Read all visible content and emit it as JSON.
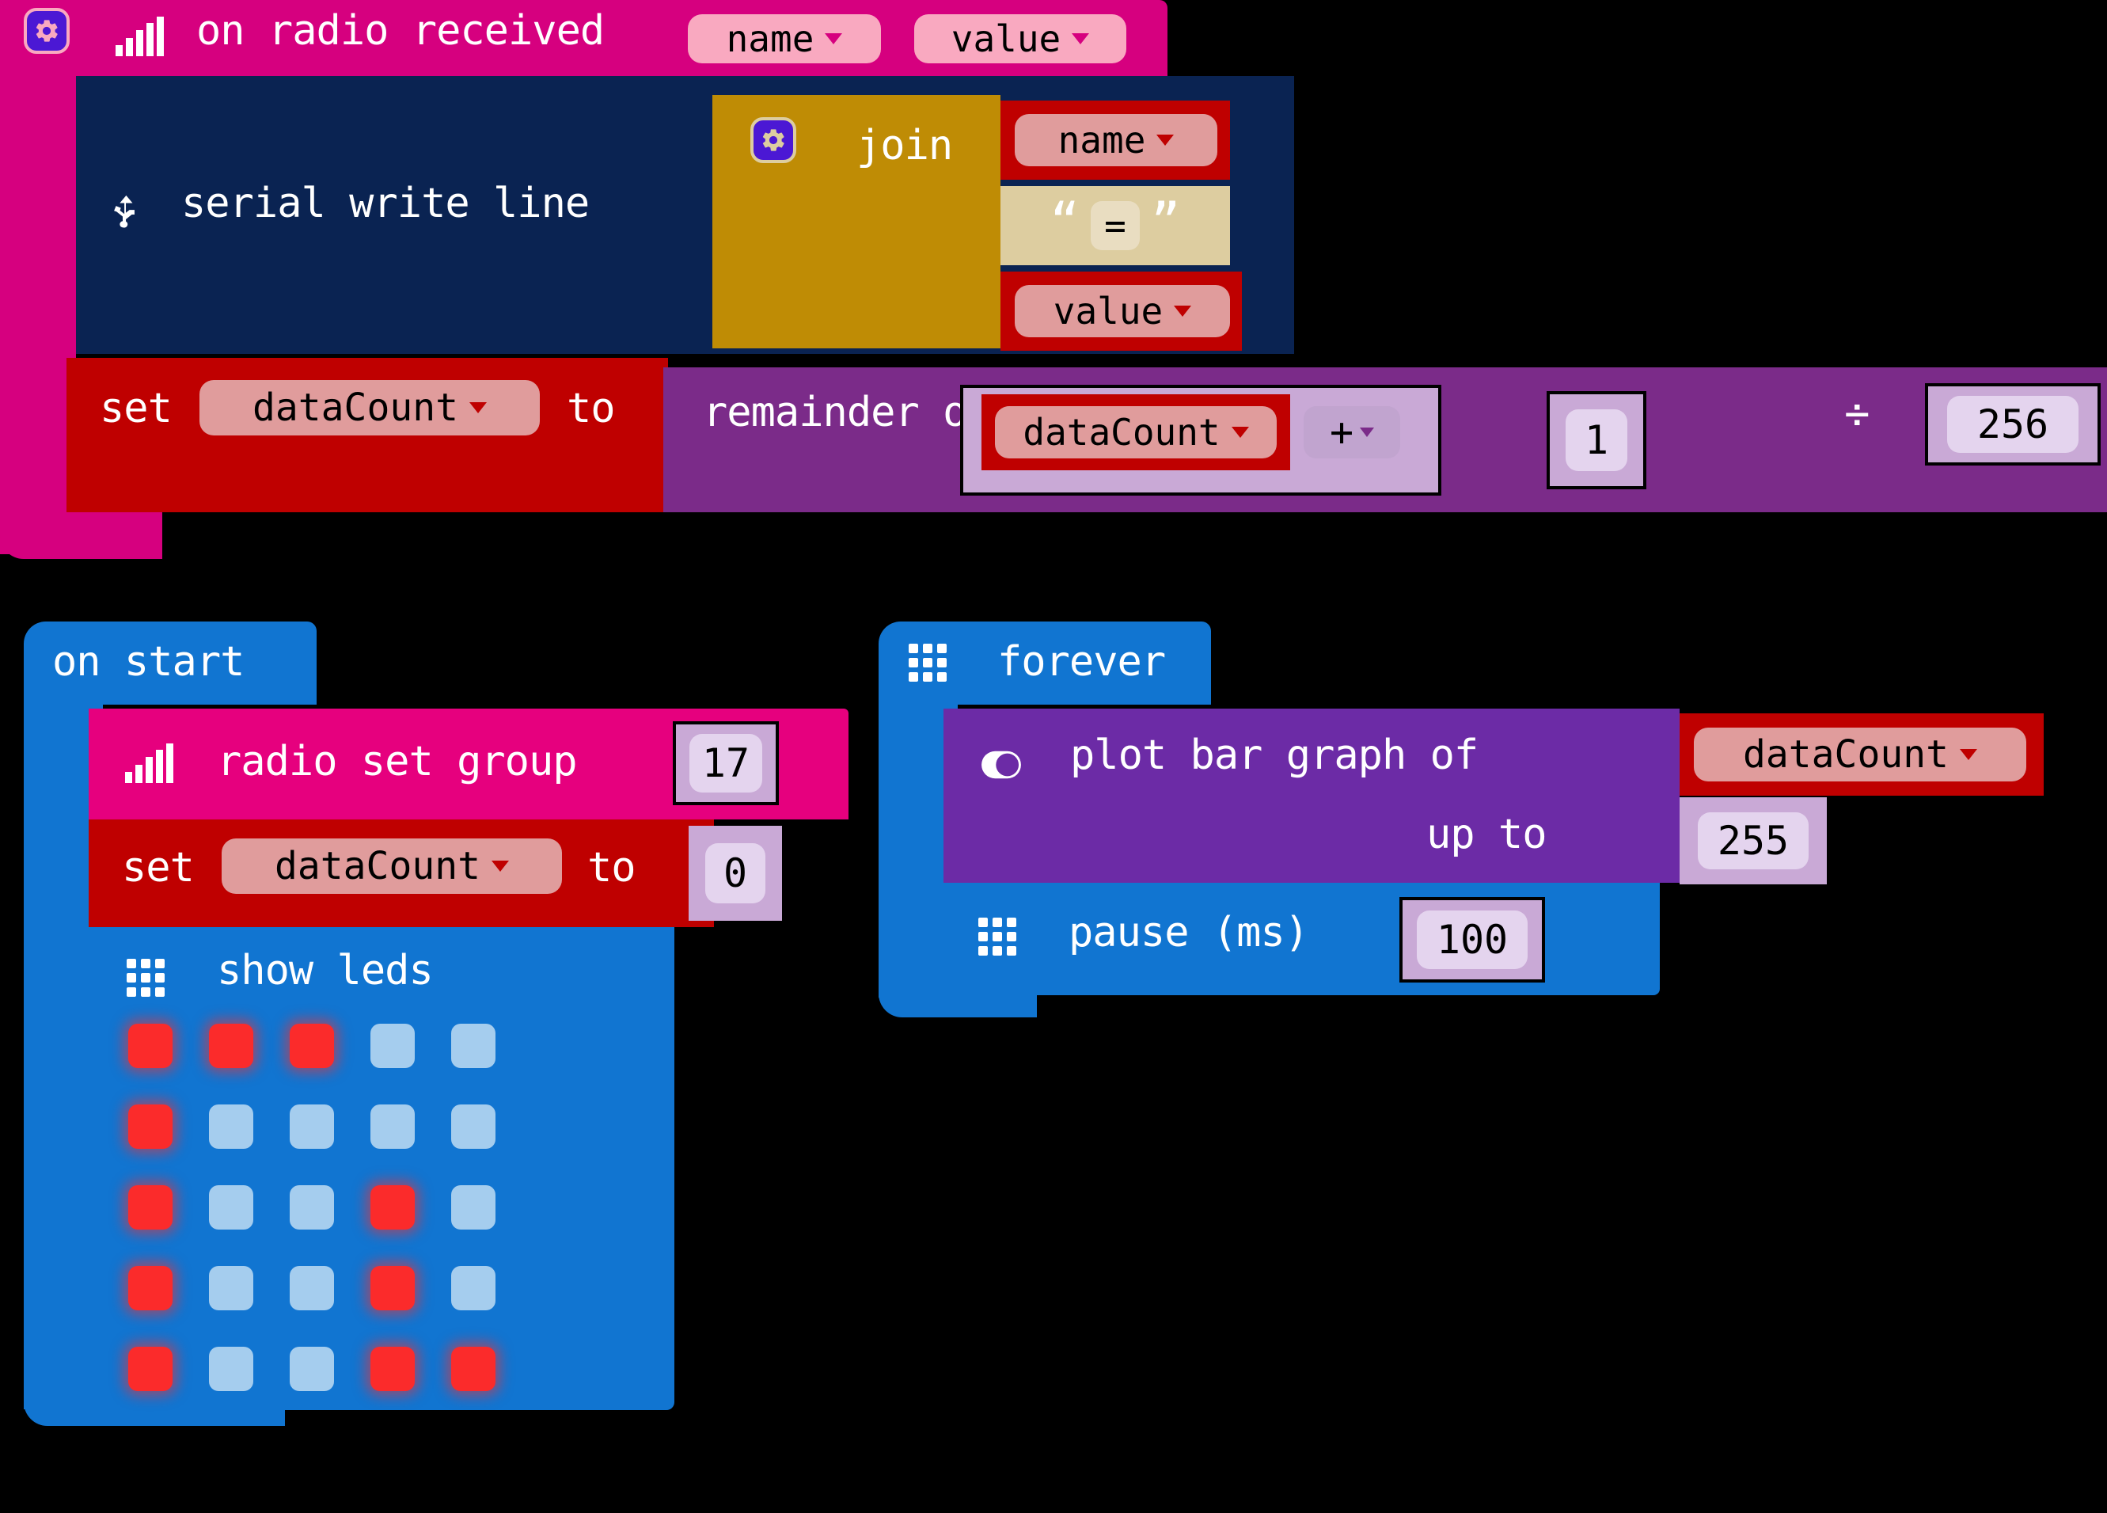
{
  "workspace": {
    "background": "#000000",
    "colors": {
      "event_magenta": "#d6007f",
      "radio_magenta": "#e6007e",
      "serial_navy": "#0a2352",
      "variable_red": "#bf0000",
      "math_purple": "#7b2b89",
      "led_blue": "#1175d1",
      "basic_blue": "#1175d1",
      "plot_purple": "#6c2ba6",
      "text_gold": "#bf8c05",
      "string_tan": "#ddcda0",
      "led_on": "#fb2b2b",
      "led_off": "#a5cdee"
    }
  },
  "blocks": {
    "on_radio_received": {
      "label": "on radio received",
      "icon": "radio-signal-icon",
      "gear_icon": "gear-icon",
      "params": [
        {
          "name": "name",
          "label": "name",
          "dropdown": "chevron-down-icon"
        },
        {
          "name": "value",
          "label": "value",
          "dropdown": "chevron-down-icon"
        }
      ],
      "children": {
        "serial_write_line": {
          "label": "serial write line",
          "icon": "usb-icon",
          "value": {
            "join": {
              "label": "join",
              "gear_icon": "gear-icon",
              "items": [
                {
                  "type": "variable",
                  "label": "name",
                  "dropdown": "chevron-down-icon"
                },
                {
                  "type": "string",
                  "label": "=",
                  "quote_open": "“",
                  "quote_close": "”"
                },
                {
                  "type": "variable",
                  "label": "value",
                  "dropdown": "chevron-down-icon"
                }
              ]
            }
          }
        },
        "set_variable": {
          "set_label": "set",
          "variable": "dataCount",
          "to_label": "to",
          "dropdown": "chevron-down-icon",
          "value": {
            "remainder": {
              "label": "remainder of",
              "divide_symbol": "÷",
              "left": {
                "arithmetic": {
                  "left_variable": "dataCount",
                  "left_dropdown": "chevron-down-icon",
                  "operator": "+",
                  "operator_dropdown": "chevron-down-icon",
                  "right_number": "1"
                }
              },
              "right_number": "256"
            }
          }
        }
      }
    },
    "on_start": {
      "label": "on start",
      "children": {
        "radio_set_group": {
          "label": "radio set group",
          "icon": "radio-signal-icon",
          "value": "17"
        },
        "set_variable": {
          "set_label": "set",
          "variable": "dataCount",
          "to_label": "to",
          "dropdown": "chevron-down-icon",
          "value": "0"
        },
        "show_leds": {
          "label": "show leds",
          "icon": "led-grid-icon",
          "matrix": [
            [
              1,
              1,
              1,
              0,
              0
            ],
            [
              1,
              0,
              0,
              0,
              0
            ],
            [
              1,
              0,
              0,
              1,
              0
            ],
            [
              1,
              0,
              0,
              1,
              0
            ],
            [
              1,
              0,
              0,
              1,
              1
            ]
          ]
        }
      }
    },
    "forever": {
      "label": "forever",
      "icon": "led-grid-icon",
      "children": {
        "plot_bar_graph": {
          "label": "plot bar graph of",
          "icon": "toggle-icon",
          "variable": "dataCount",
          "dropdown": "chevron-down-icon",
          "up_to_label": "up to",
          "up_to_value": "255"
        },
        "pause": {
          "label": "pause (ms)",
          "icon": "led-grid-icon",
          "value": "100"
        }
      }
    }
  }
}
